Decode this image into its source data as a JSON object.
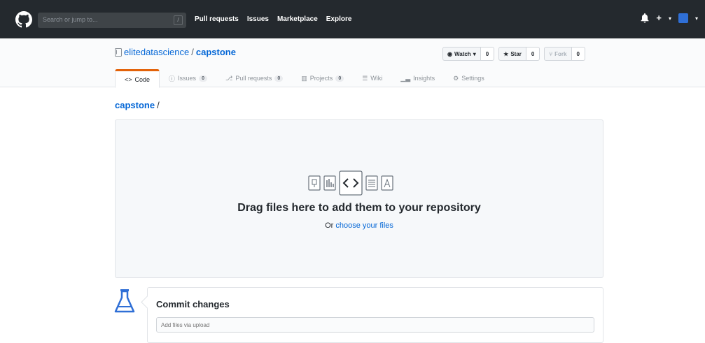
{
  "header": {
    "search_placeholder": "Search or jump to...",
    "search_shortcut": "/",
    "nav": [
      "Pull requests",
      "Issues",
      "Marketplace",
      "Explore"
    ],
    "plus": "+"
  },
  "repo": {
    "owner": "elitedatascience",
    "separator": "/",
    "name": "capstone",
    "watch_label": "Watch",
    "watch_count": "0",
    "star_label": "Star",
    "star_count": "0",
    "fork_label": "Fork",
    "fork_count": "0"
  },
  "tabs": [
    {
      "label": "Code",
      "icon": "code-icon"
    },
    {
      "label": "Issues",
      "count": "0",
      "icon": "issue-icon"
    },
    {
      "label": "Pull requests",
      "count": "0",
      "icon": "pull-request-icon"
    },
    {
      "label": "Projects",
      "count": "0",
      "icon": "project-icon"
    },
    {
      "label": "Wiki",
      "icon": "wiki-icon"
    },
    {
      "label": "Insights",
      "icon": "insights-icon"
    },
    {
      "label": "Settings",
      "icon": "gear-icon"
    }
  ],
  "breadcrumb": {
    "repo": "capstone",
    "slash": "/"
  },
  "dropzone": {
    "title": "Drag files here to add them to your repository",
    "sub_prefix": "Or ",
    "sub_link": "choose your files"
  },
  "commit": {
    "title": "Commit changes",
    "input_placeholder": "Add files via upload"
  },
  "colors": {
    "header_bg": "#24292e",
    "link": "#0366d6",
    "active_tab": "#e36209"
  }
}
